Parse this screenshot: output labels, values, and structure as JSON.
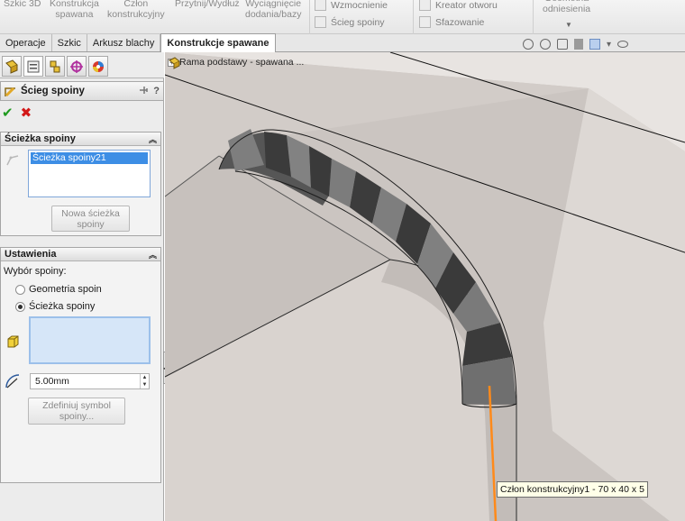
{
  "ribbon": {
    "items": [
      {
        "label": "Szkic 3D"
      },
      {
        "label": "Konstrukcja\nspawana"
      },
      {
        "label": "Człon\nkonstrukcyjny"
      },
      {
        "label": "Przytnij/Wydłuż"
      },
      {
        "label": "Wyciągnięcie\ndodania/bazy"
      }
    ],
    "group2": {
      "wzmocnienie": "Wzmocnienie",
      "sciegspoiny": "Ścieg spoiny"
    },
    "group3": {
      "kreator": "Kreator otworu",
      "sfazowanie": "Sfazowanie"
    },
    "group4": {
      "geometria": "Geometria\nodniesienia"
    }
  },
  "tabs": [
    {
      "label": "Operacje"
    },
    {
      "label": "Szkic"
    },
    {
      "label": "Arkusz blachy"
    },
    {
      "label": "Konstrukcje spawane",
      "active": true
    }
  ],
  "property_manager": {
    "title": "Ścieg spoiny",
    "help": "?",
    "ok": "✔",
    "cancel": "✖",
    "path_group": {
      "header": "Ścieżka spoiny",
      "selected": "Ścieżka spoiny21",
      "new_button": "Nowa ścieżka\nspoiny"
    },
    "settings_group": {
      "header": "Ustawienia",
      "selection_label": "Wybór spoiny:",
      "options": [
        "Geometria spoin",
        "Ścieżka spoiny"
      ],
      "selected_option": "Ścieżka spoiny",
      "size_value": "5.00mm",
      "symbol_button": "Zdefiniuj symbol\nspoiny..."
    }
  },
  "viewport": {
    "tree_label": "Rama podstawy - spawana ...",
    "tooltip": "Człon konstrukcyjny1 - 70 x 40 x 5",
    "bead_colors": [
      "#3a3a3a",
      "#7a7a7a"
    ],
    "body_color": "#d8d2ce",
    "accent_line": "#ff8a1a"
  }
}
